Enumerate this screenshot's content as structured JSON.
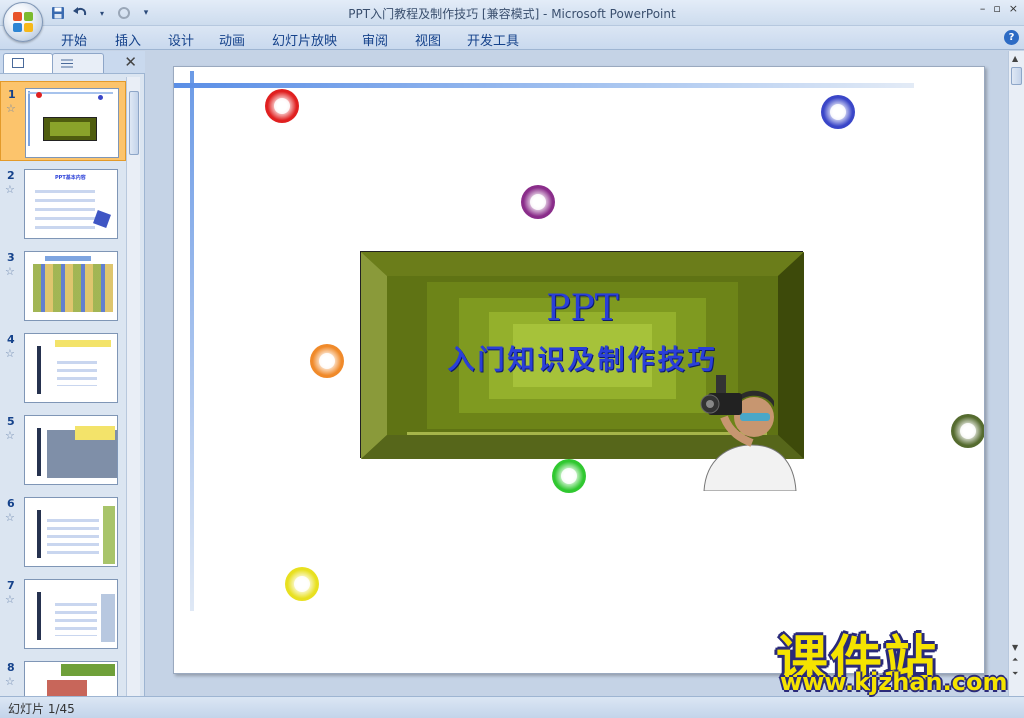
{
  "window": {
    "title": "PPT入门教程及制作技巧 [兼容模式] - Microsoft PowerPoint",
    "controls": [
      "–",
      "▫",
      "×"
    ]
  },
  "quick_access": {
    "save_icon": "save-icon",
    "undo_icon": "undo-icon",
    "redo_icon": "redo-icon",
    "customize_icon": "customize-qat-icon"
  },
  "ribbon": {
    "tabs": [
      {
        "label": "开始"
      },
      {
        "label": "插入"
      },
      {
        "label": "设计"
      },
      {
        "label": "动画"
      },
      {
        "label": "幻灯片放映"
      },
      {
        "label": "审阅"
      },
      {
        "label": "视图"
      },
      {
        "label": "开发工具"
      }
    ],
    "help_label": "?"
  },
  "slides_pane": {
    "thumbnails": [
      {
        "number": "1",
        "selected": true
      },
      {
        "number": "2",
        "title": "PPT基本内容"
      },
      {
        "number": "3"
      },
      {
        "number": "4"
      },
      {
        "number": "5"
      },
      {
        "number": "6"
      },
      {
        "number": "7"
      },
      {
        "number": "8"
      }
    ]
  },
  "slide": {
    "title": "PPT",
    "subtitle": "入门知识及制作技巧"
  },
  "status": {
    "slide_indicator": "幻灯片 1/45"
  },
  "watermark": {
    "main": "课件站",
    "url": "www.kjzhan.com"
  },
  "colors": {
    "balls": [
      "#e02020",
      "#3a46c8",
      "#8a2d8a",
      "#f08a2a",
      "#30c830",
      "#556b2f",
      "#e8e020"
    ],
    "frame_dark": "#4f5d0f",
    "frame_mid": "#6b7d1a",
    "title_blue": "#2a3fd8"
  }
}
